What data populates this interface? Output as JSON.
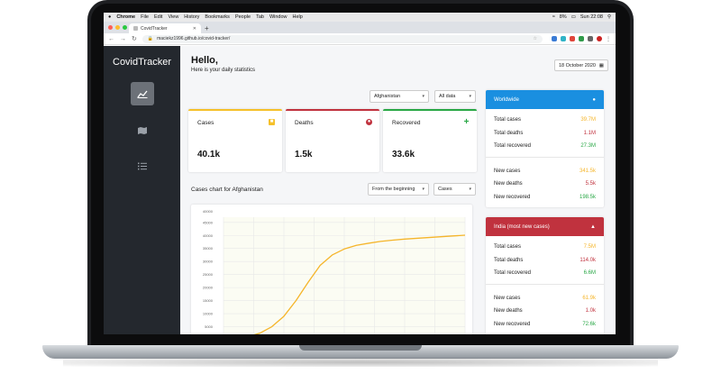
{
  "menubar": {
    "apple": "",
    "app": "Chrome",
    "items": [
      "File",
      "Edit",
      "View",
      "History",
      "Bookmarks",
      "People",
      "Tab",
      "Window",
      "Help"
    ],
    "battery": "8%",
    "clock": "Sun 22:08"
  },
  "browser": {
    "tab_title": "CovidTracker",
    "url": "maciekz1996.github.io/covid-tracker/"
  },
  "sidebar": {
    "brand": "CovidTracker"
  },
  "header": {
    "greeting": "Hello,",
    "subtitle": "Here is your daily statistics",
    "date": "18 October 2020"
  },
  "filters": {
    "country": "Afghanistan",
    "range": "All data"
  },
  "cards": [
    {
      "label": "Cases",
      "value": "40.1k",
      "color": "#f5c02a"
    },
    {
      "label": "Deaths",
      "value": "1.5k",
      "color": "#c0323e"
    },
    {
      "label": "Recovered",
      "value": "33.6k",
      "color": "#28a745"
    }
  ],
  "chart": {
    "title": "Cases chart for Afghanistan",
    "period": "From the beginning",
    "metric": "Cases"
  },
  "chart_data": {
    "type": "line",
    "yticks": [
      "40000",
      "45000",
      "40000",
      "35000",
      "30000",
      "25000",
      "20000",
      "15000",
      "10000",
      "5000"
    ],
    "series": [
      {
        "x": [
          0,
          1,
          2,
          3,
          4,
          5,
          6,
          7,
          8,
          9,
          10,
          11,
          12,
          13,
          14,
          15,
          16,
          17,
          18,
          19,
          20
        ],
        "values": [
          0,
          500,
          1200,
          2500,
          5000,
          9000,
          15000,
          22000,
          28500,
          32500,
          34800,
          36200,
          37000,
          37700,
          38200,
          38600,
          38900,
          39200,
          39500,
          39800,
          40100
        ]
      }
    ],
    "ylim": [
      0,
      47000
    ],
    "color": "#f5b52a"
  },
  "worldwide": {
    "title": "Worldwide",
    "totals": [
      {
        "label": "Total cases",
        "value": "39.7M",
        "color": "#f5b52a"
      },
      {
        "label": "Total deaths",
        "value": "1.1M",
        "color": "#c0323e"
      },
      {
        "label": "Total recovered",
        "value": "27.3M",
        "color": "#28a745"
      }
    ],
    "new": [
      {
        "label": "New cases",
        "value": "341.5k",
        "color": "#f5b52a"
      },
      {
        "label": "New deaths",
        "value": "5.5k",
        "color": "#c0323e"
      },
      {
        "label": "New recovered",
        "value": "198.5k",
        "color": "#28a745"
      }
    ],
    "header_color": "#1a8fe0"
  },
  "india": {
    "title": "India (most new cases)",
    "totals": [
      {
        "label": "Total cases",
        "value": "7.5M",
        "color": "#f5b52a"
      },
      {
        "label": "Total deaths",
        "value": "114.0k",
        "color": "#c0323e"
      },
      {
        "label": "Total recovered",
        "value": "6.6M",
        "color": "#28a745"
      }
    ],
    "new": [
      {
        "label": "New cases",
        "value": "61.9k",
        "color": "#f5b52a"
      },
      {
        "label": "New deaths",
        "value": "1.0k",
        "color": "#c0323e"
      },
      {
        "label": "New recovered",
        "value": "72.6k",
        "color": "#28a745"
      }
    ],
    "header_color": "#c0323e"
  }
}
